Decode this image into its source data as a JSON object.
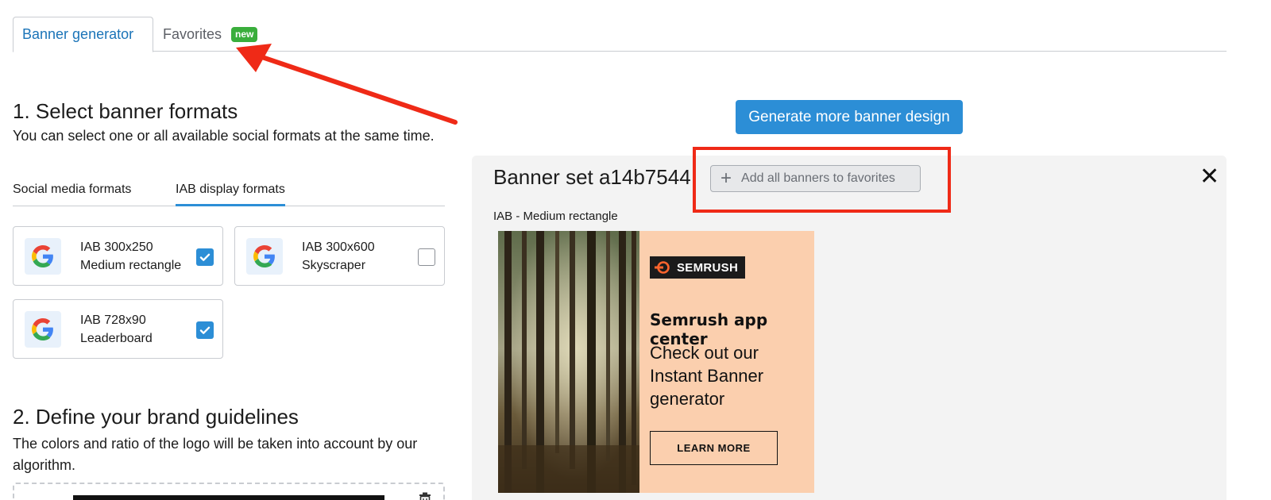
{
  "tabs": {
    "generator": "Banner generator",
    "favorites": "Favorites",
    "new_badge": "new"
  },
  "section1": {
    "heading": "1. Select banner formats",
    "description": "You can select one or all available social formats at the same time.",
    "subtabs": {
      "social": "Social media formats",
      "iab": "IAB display formats"
    },
    "formats": [
      {
        "title": "IAB 300x250",
        "subtitle": "Medium rectangle",
        "checked": true
      },
      {
        "title": "IAB 300x600",
        "subtitle": "Skyscraper",
        "checked": false
      },
      {
        "title": "IAB 728x90",
        "subtitle": "Leaderboard",
        "checked": true
      }
    ]
  },
  "section2": {
    "heading": "2. Define your brand guidelines",
    "description": "The colors and ratio of the logo will be taken into account by our algorithm."
  },
  "generate_button": "Generate more banner design",
  "banner_set": {
    "title": "Banner set a14b7544",
    "add_favorites": "Add all banners to favorites",
    "format_label": "IAB - Medium rectangle"
  },
  "ad": {
    "brand": "SEMRUSH",
    "headline": "Semrush app center",
    "body": "Check out our Instant Banner generator",
    "cta": "LEARN MORE"
  },
  "icons": {
    "google": "google-g-icon",
    "check": "checkmark-icon",
    "close": "close-icon",
    "plus": "plus-icon",
    "trash": "trash-icon"
  },
  "colors": {
    "primary": "#2c8ed6",
    "link": "#1b74b8",
    "new_badge": "#3aae3c",
    "annotation": "#ef2a17",
    "ad_background": "#fbcfae"
  }
}
